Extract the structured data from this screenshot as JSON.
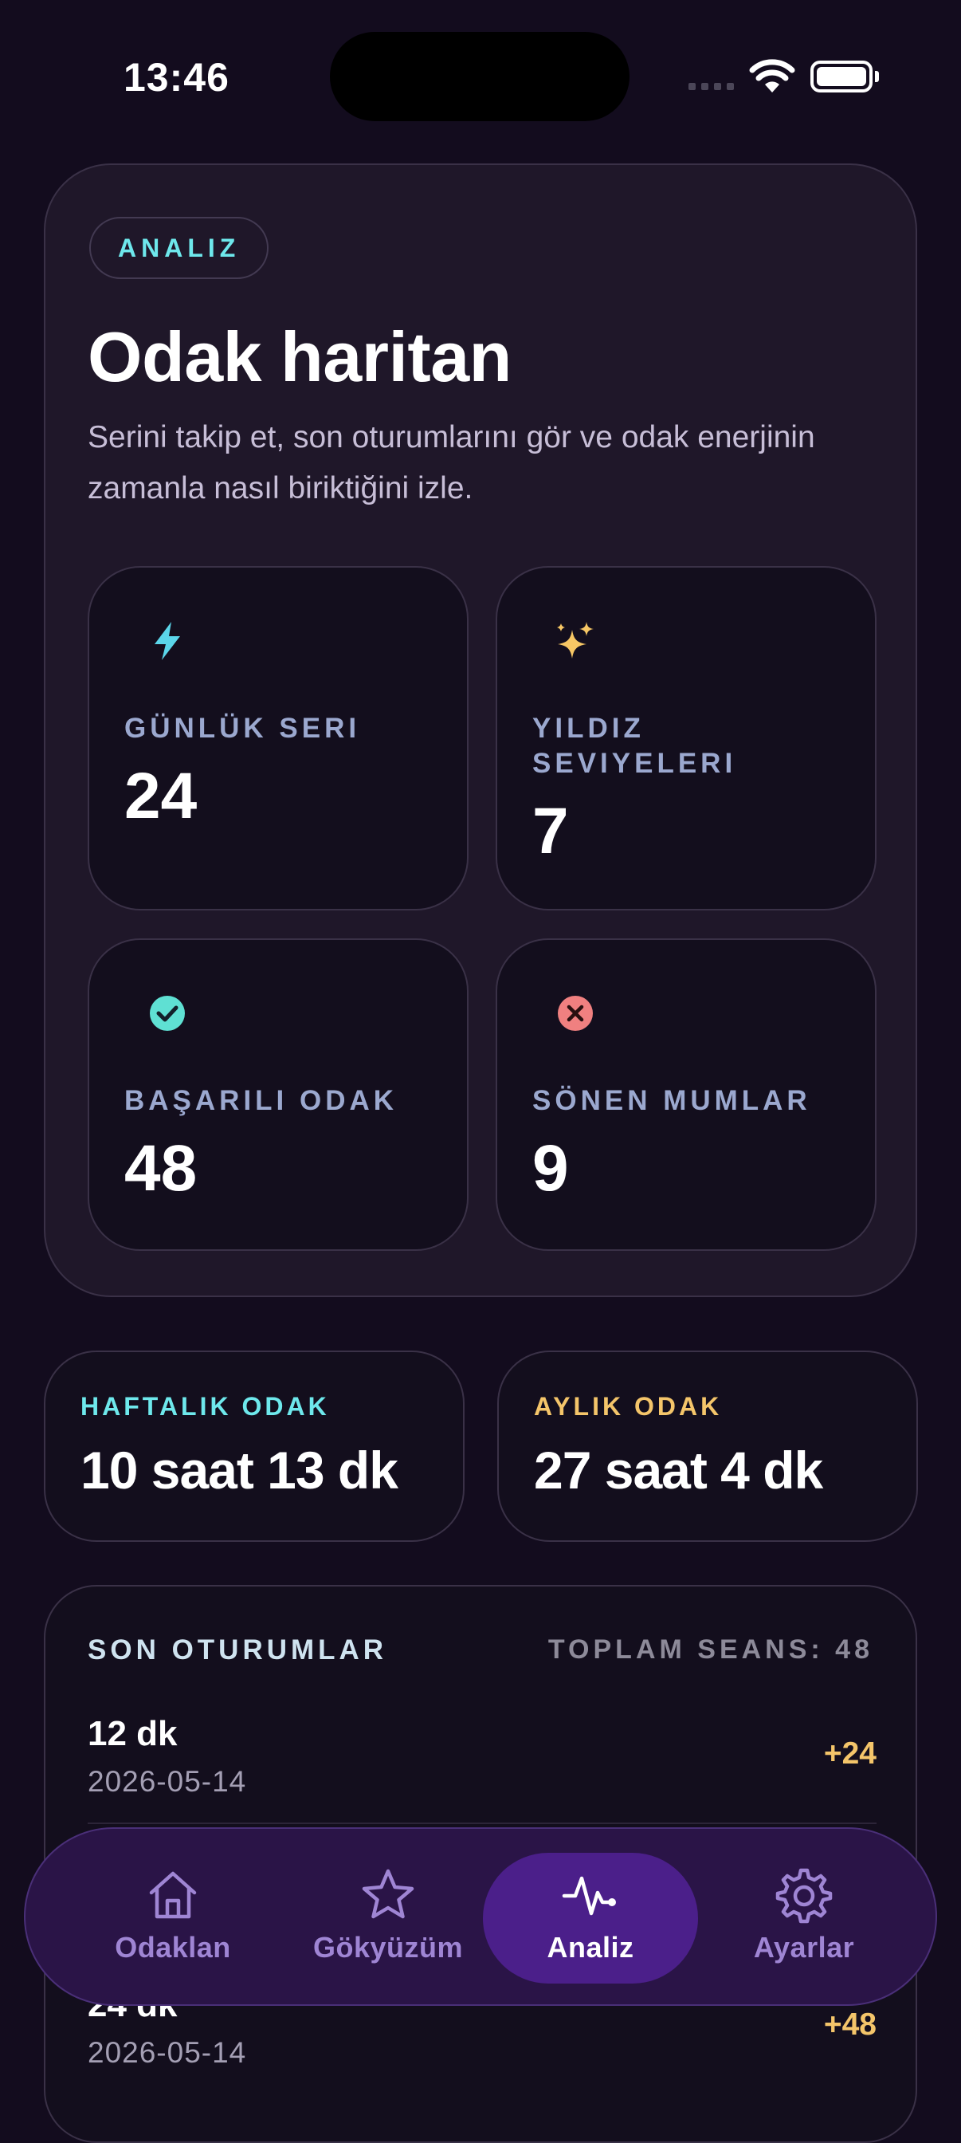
{
  "status": {
    "time": "13:46"
  },
  "hero": {
    "badge": "ANALIZ",
    "title": "Odak haritan",
    "subtitle": "Serini takip et, son oturumlarını gör ve odak enerjinin zamanla nasıl biriktiğini izle."
  },
  "stats": [
    {
      "label": "GÜNLÜK SERI",
      "value": "24",
      "icon": "lightning-icon"
    },
    {
      "label": "YILDIZ SEVIYELERI",
      "value": "7",
      "icon": "sparkles-icon"
    },
    {
      "label": "BAŞARILI ODAK",
      "value": "48",
      "icon": "check-circle-icon"
    },
    {
      "label": "SÖNEN MUMLAR",
      "value": "9",
      "icon": "x-circle-icon"
    }
  ],
  "weekly": {
    "label": "HAFTALIK ODAK",
    "value": "10 saat 13 dk"
  },
  "monthly": {
    "label": "AYLIK ODAK",
    "value": "27 saat 4 dk"
  },
  "sessions": {
    "title": "SON OTURUMLAR",
    "total": "TOPLAM SEANS: 48",
    "rows": [
      {
        "duration": "12 dk",
        "date": "2026-05-14",
        "points": "+24"
      },
      {
        "duration": "24 dk",
        "date": "2026-05-14",
        "points": "+48"
      }
    ]
  },
  "tabs": [
    {
      "label": "Odaklan",
      "icon": "home-icon"
    },
    {
      "label": "Gökyüzüm",
      "icon": "star-icon"
    },
    {
      "label": "Analiz",
      "icon": "pulse-icon",
      "active": true
    },
    {
      "label": "Ayarlar",
      "icon": "gear-icon"
    }
  ],
  "colors": {
    "cyan": "#6ee8ec",
    "gold": "#f4c56a",
    "accent": "#4b1f8a"
  }
}
